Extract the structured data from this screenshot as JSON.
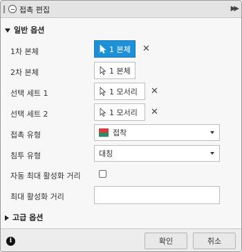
{
  "title": "접촉 편집",
  "sections": {
    "general": "일반 옵션",
    "advanced": "고급 옵션"
  },
  "fields": {
    "body1": {
      "label": "1차 본체",
      "value": "1 본체"
    },
    "body2": {
      "label": "2차 본체",
      "value": "1 본체"
    },
    "set1": {
      "label": "선택 세트 1",
      "value": "1 모서리"
    },
    "set2": {
      "label": "선택 세트 2",
      "value": "1 모서리"
    },
    "contact_type": {
      "label": "접촉 유형",
      "value": "접착"
    },
    "penetration_type": {
      "label": "침투 유형",
      "value": "대칭"
    },
    "auto_max_activation": {
      "label": "자동 최대 활성화 거리"
    },
    "max_activation": {
      "label": "최대 활성화 거리",
      "value": ""
    }
  },
  "buttons": {
    "ok": "확인",
    "cancel": "취소"
  },
  "icons": {
    "title": "contact-edit-icon",
    "selection": "cursor-arrow-icon",
    "clear": "close-x-icon",
    "contact_type": "bonded-contact-icon",
    "info": "info-icon",
    "expand": "double-chevron-right-icon"
  },
  "colors": {
    "active_selection": "#1e91d6",
    "contact_top": "#e03a3a",
    "contact_bottom": "#2a8a6a"
  }
}
